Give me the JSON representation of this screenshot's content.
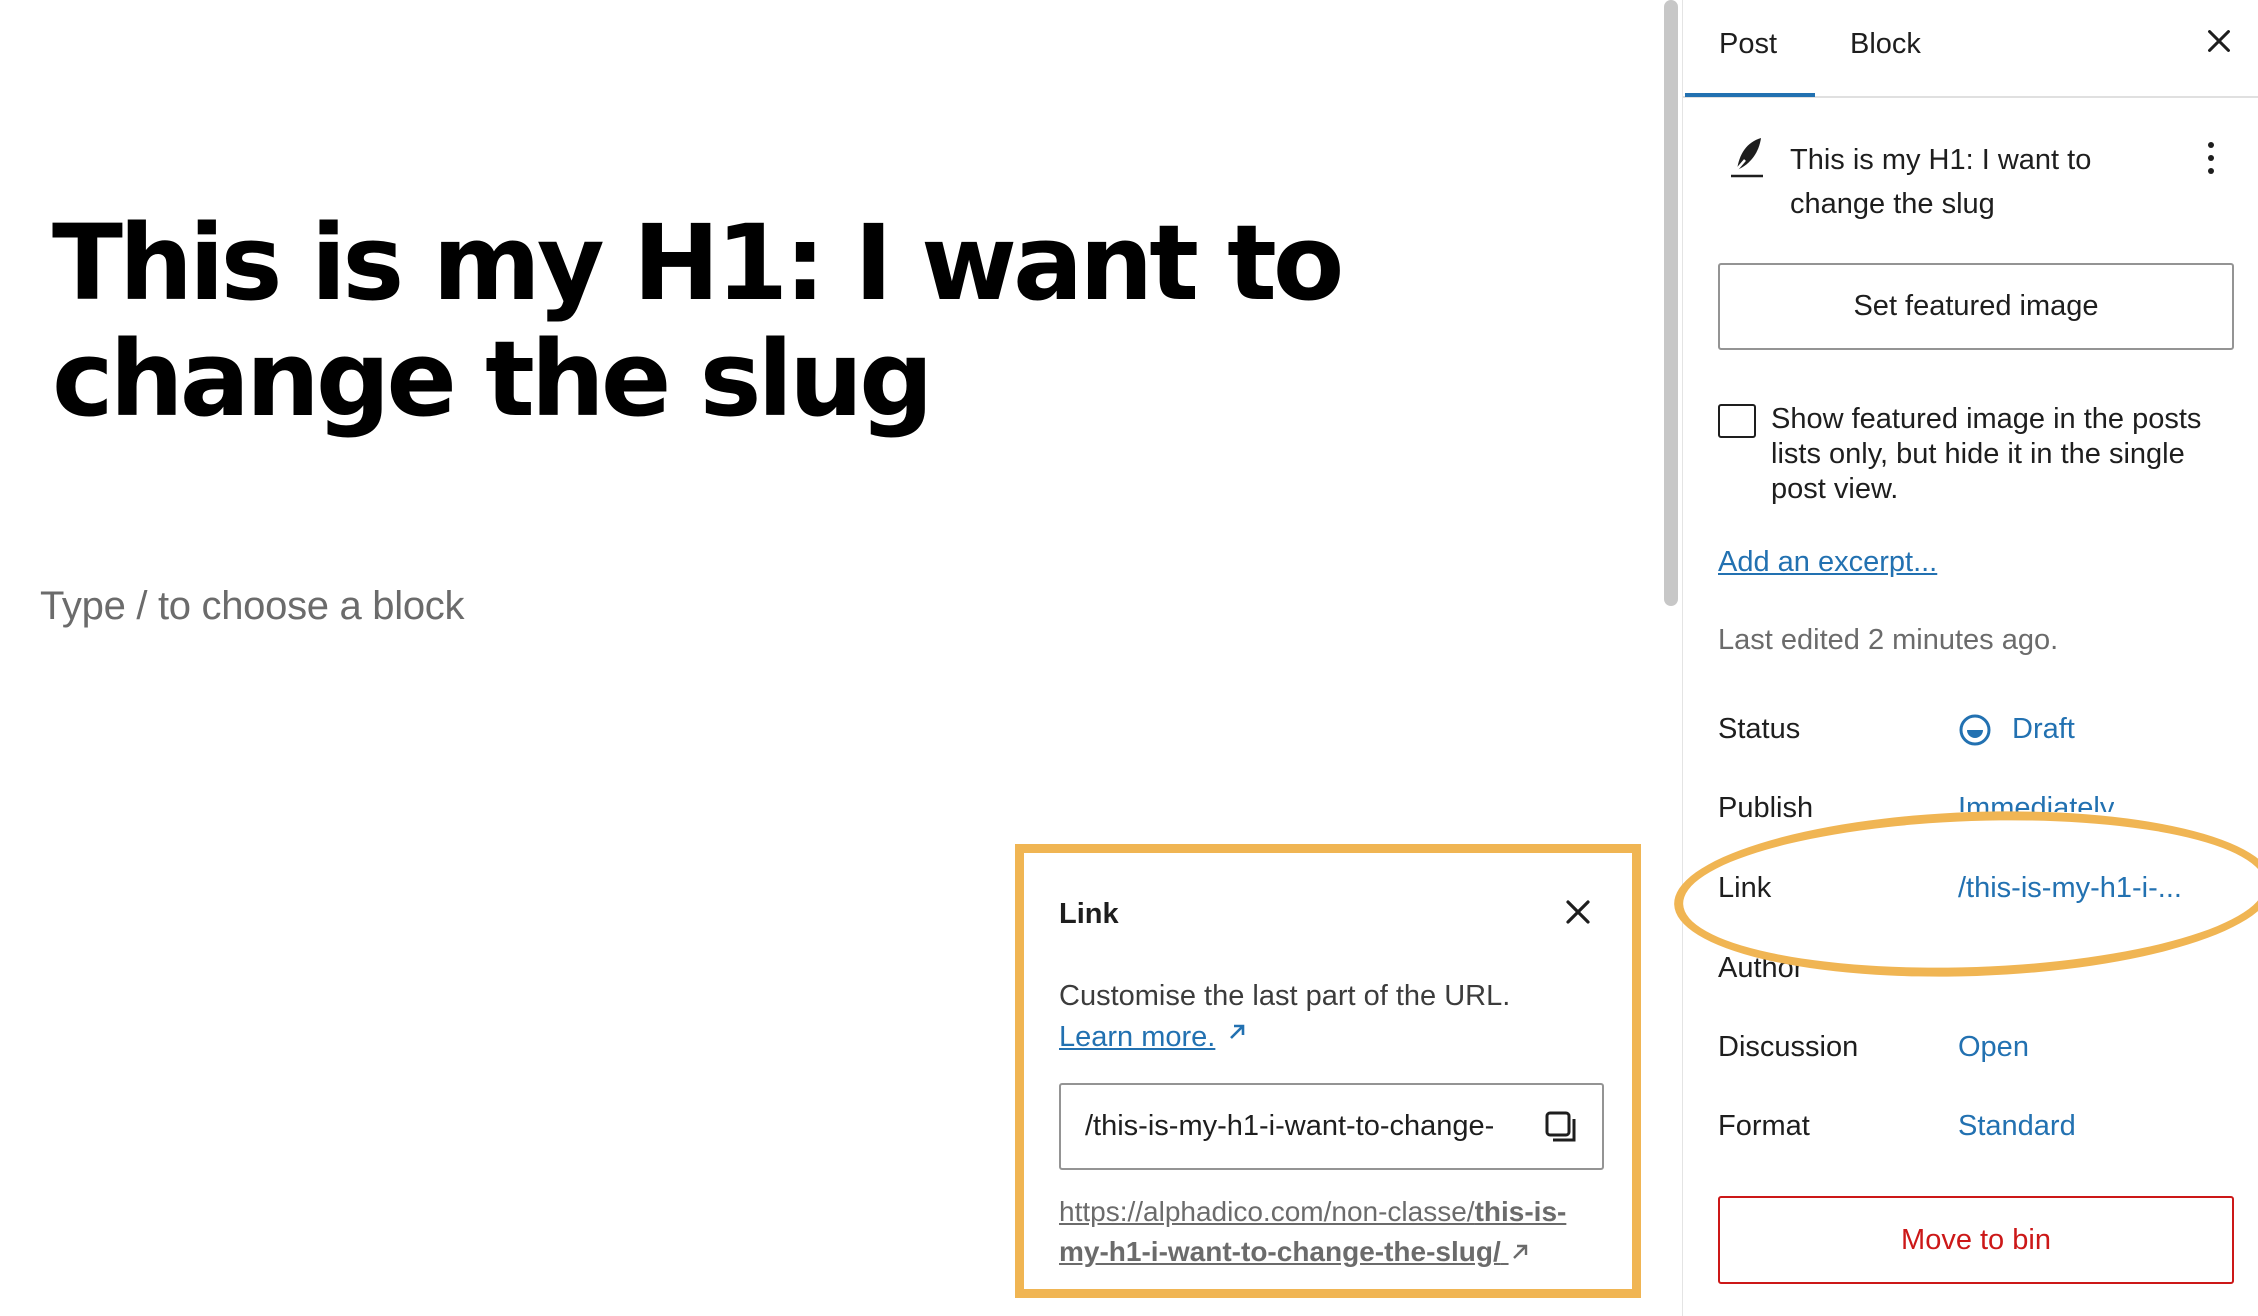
{
  "editor": {
    "title": "This is my H1: I want to change the slug",
    "block_placeholder": "Type / to choose a block"
  },
  "link_popover": {
    "title": "Link",
    "help_text": "Customise the last part of the URL.",
    "learn_more": "Learn more.",
    "slug_value": "/this-is-my-h1-i-want-to-change-",
    "url_prefix": "https://alphadico.com/non-classe/",
    "url_slug": "this-is-my-h1-i-want-to-change-the-slug/"
  },
  "sidebar": {
    "tabs": [
      {
        "label": "Post",
        "active": true
      },
      {
        "label": "Block",
        "active": false
      }
    ],
    "summary_title": "This is my H1: I want to change the slug",
    "featured_image_button": "Set featured image",
    "featured_image_checkbox_label": "Show featured image in the posts lists only, but hide it in the single post view.",
    "excerpt_link": "Add an excerpt...",
    "last_edited": "Last edited 2 minutes ago.",
    "rows": {
      "status": {
        "label": "Status",
        "value": "Draft"
      },
      "publish": {
        "label": "Publish",
        "value": "Immediately"
      },
      "link": {
        "label": "Link",
        "value": "/this-is-my-h1-i-..."
      },
      "author": {
        "label": "Author",
        "value": ""
      },
      "discussion": {
        "label": "Discussion",
        "value": "Open"
      },
      "format": {
        "label": "Format",
        "value": "Standard"
      }
    },
    "move_to_bin": "Move to bin"
  },
  "icons": {
    "close": "close-icon",
    "copy": "copy-icon",
    "external": "external-link-icon",
    "feather": "feather-icon",
    "more": "more-vertical-icon",
    "draft": "draft-status-icon"
  },
  "colors": {
    "accent": "#2271b1",
    "highlight": "#f0b553",
    "destructive": "#cc1818",
    "muted_text": "#6b6b6b"
  }
}
